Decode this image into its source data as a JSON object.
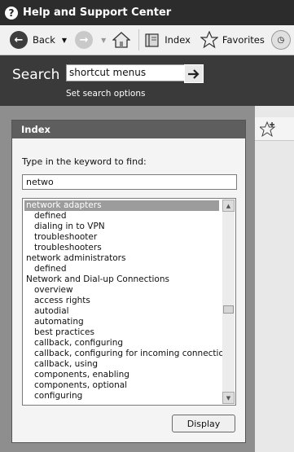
{
  "window": {
    "title": "Help and Support Center"
  },
  "toolbar": {
    "back_label": "Back",
    "index_label": "Index",
    "favorites_label": "Favorites"
  },
  "search": {
    "label": "Search",
    "value": "shortcut menus",
    "options_link": "Set search options"
  },
  "index_panel": {
    "title": "Index",
    "prompt": "Type in the keyword to find:",
    "keyword_value": "netwo",
    "display_button": "Display",
    "items": [
      {
        "label": "network adapters",
        "level": 0,
        "selected": true
      },
      {
        "label": "defined",
        "level": 1
      },
      {
        "label": "dialing in to VPN",
        "level": 1
      },
      {
        "label": "troubleshooter",
        "level": 1
      },
      {
        "label": "troubleshooters",
        "level": 1
      },
      {
        "label": "network administrators",
        "level": 0
      },
      {
        "label": "defined",
        "level": 1
      },
      {
        "label": "Network and Dial-up Connections",
        "level": 0
      },
      {
        "label": "overview",
        "level": 1
      },
      {
        "label": "access rights",
        "level": 1
      },
      {
        "label": "autodial",
        "level": 1
      },
      {
        "label": "automating",
        "level": 1
      },
      {
        "label": "best practices",
        "level": 1
      },
      {
        "label": "callback, configuring",
        "level": 1
      },
      {
        "label": "callback, configuring for incoming connections",
        "level": 1
      },
      {
        "label": "callback, using",
        "level": 1
      },
      {
        "label": "components, enabling",
        "level": 1
      },
      {
        "label": "components, optional",
        "level": 1
      },
      {
        "label": "configuring",
        "level": 1
      }
    ]
  }
}
